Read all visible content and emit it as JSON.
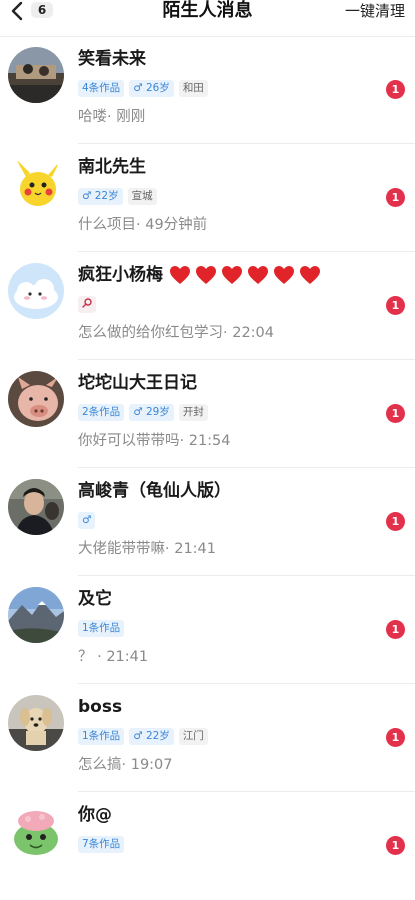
{
  "header": {
    "back_count": "6",
    "title": "陌生人消息",
    "clear_label": "一键清理"
  },
  "colors": {
    "badge_red": "#e4314b",
    "tag_blue": "#3a86d6",
    "heart_red": "#e0242a"
  },
  "conversations": [
    {
      "name": "笑看未来",
      "hearts": 0,
      "tags": [
        "4条作品",
        "♂ 26岁",
        "和田"
      ],
      "preview": "哈喽· 刚刚",
      "unread": "1",
      "avatar_icon": "landscape-photo"
    },
    {
      "name": "南北先生",
      "hearts": 0,
      "tags": [
        "♂ 22岁",
        "宣城"
      ],
      "preview": "什么项目· 49分钟前",
      "unread": "1",
      "avatar_icon": "pikachu"
    },
    {
      "name": "疯狂小杨梅",
      "hearts": 6,
      "tags": [
        "search-icon"
      ],
      "preview": "怎么做的给你红包学习· 22:04",
      "unread": "1",
      "avatar_icon": "cloud-plush"
    },
    {
      "name": "坨坨山大王日记",
      "hearts": 0,
      "tags": [
        "2条作品",
        "♂ 29岁",
        "开封"
      ],
      "preview": "你好可以带带吗· 21:54",
      "unread": "1",
      "avatar_icon": "pig"
    },
    {
      "name": "高峻青（龟仙人版）",
      "hearts": 0,
      "tags": [
        "♂"
      ],
      "preview": "大佬能带带嘛· 21:41",
      "unread": "1",
      "avatar_icon": "person-photo"
    },
    {
      "name": "及它",
      "hearts": 0,
      "tags": [
        "1条作品"
      ],
      "preview": "？ · 21:41",
      "unread": "1",
      "avatar_icon": "mountain-photo"
    },
    {
      "name": "boss",
      "hearts": 0,
      "tags": [
        "1条作品",
        "♂ 22岁",
        "江门"
      ],
      "preview": "怎么搞· 19:07",
      "unread": "1",
      "avatar_icon": "dog-photo"
    },
    {
      "name": "你@",
      "hearts": 0,
      "tags": [
        "7条作品"
      ],
      "preview": "",
      "unread": "1",
      "avatar_icon": "frog-cartoon"
    }
  ]
}
